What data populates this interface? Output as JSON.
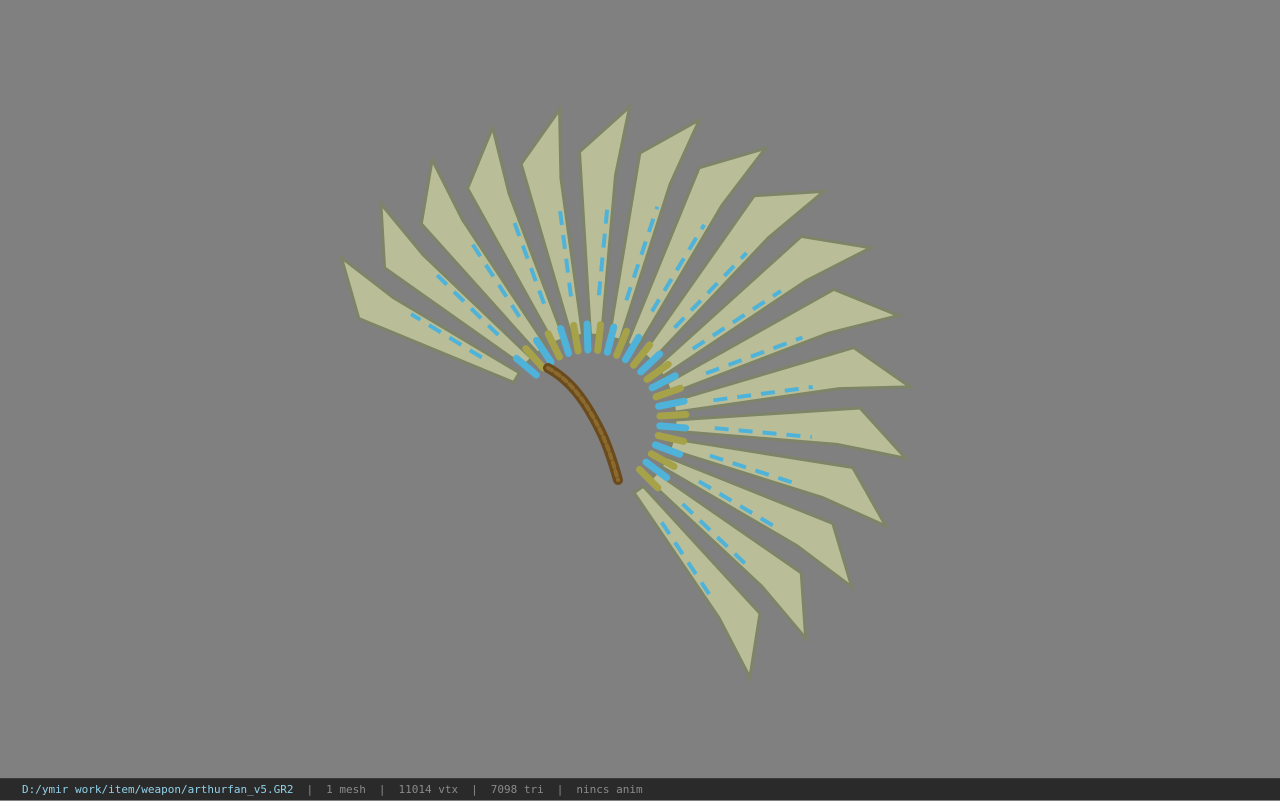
{
  "viewport": {
    "background": "#808080",
    "model_icon": "feather-fan-weapon-model",
    "colors": {
      "blade": "#b9be98",
      "blade_shadow": "#7d8467",
      "inlay": "#4fb3d9",
      "gold": "#a6a24a",
      "handle": "#6b4a1c"
    }
  },
  "status": {
    "file_path": "D:/ymir work/item/weapon/arthurfan_v5.GR2",
    "separator": "|",
    "mesh_count": "1 mesh",
    "vertex_count": "11014 vtx",
    "triangle_count": "7098 tri",
    "animation": "nincs anim"
  }
}
